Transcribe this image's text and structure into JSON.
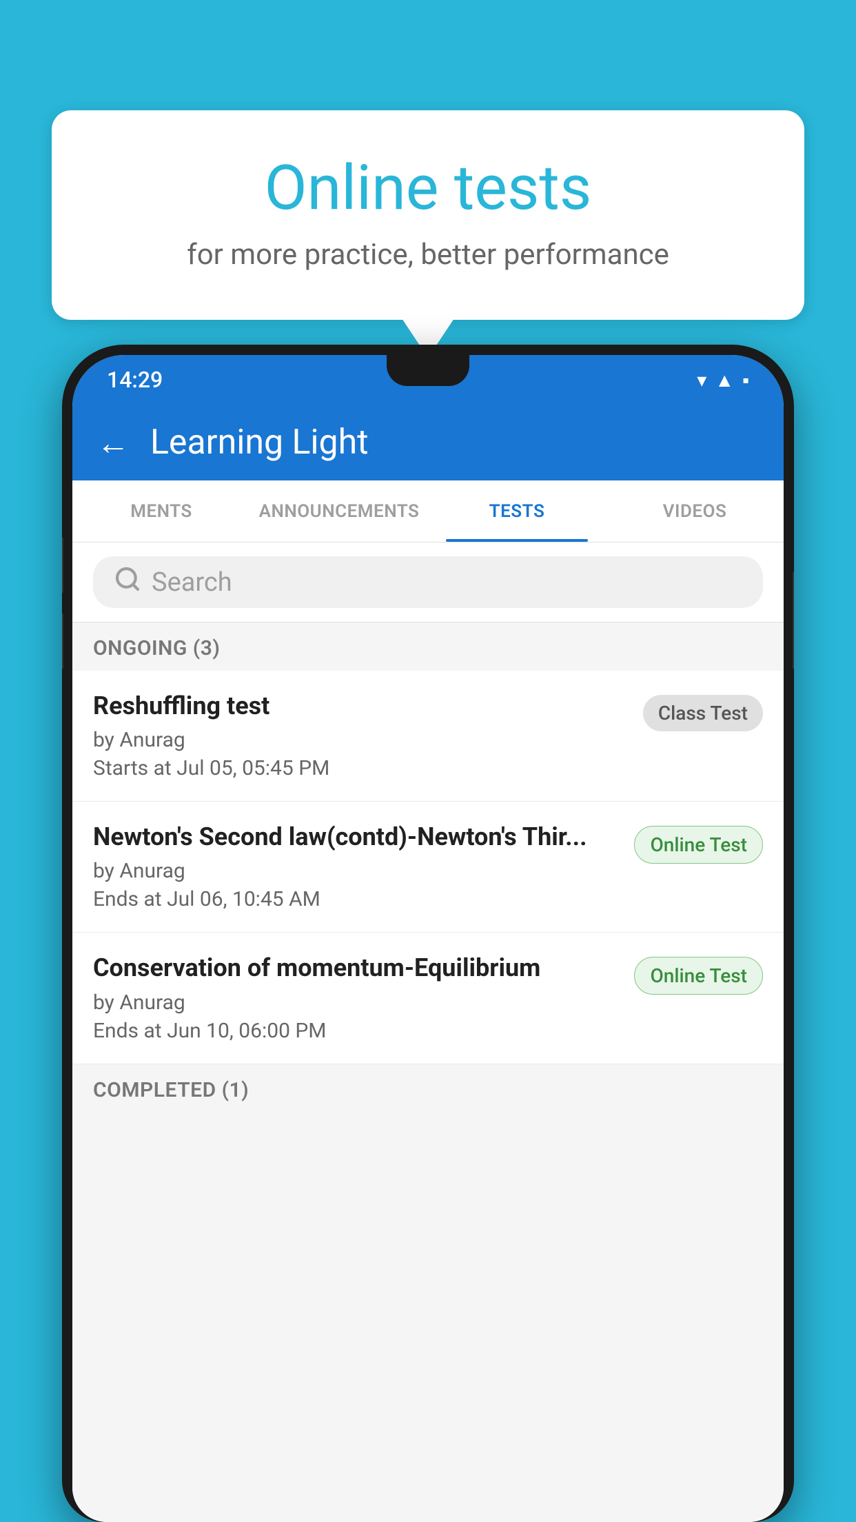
{
  "background_color": "#29b6d8",
  "speech_bubble": {
    "title": "Online tests",
    "subtitle": "for more practice, better performance"
  },
  "phone": {
    "status_bar": {
      "time": "14:29",
      "icons": [
        "wifi",
        "signal",
        "battery"
      ]
    },
    "app_bar": {
      "back_label": "←",
      "title": "Learning Light"
    },
    "tabs": [
      {
        "label": "MENTS",
        "active": false
      },
      {
        "label": "ANNOUNCEMENTS",
        "active": false
      },
      {
        "label": "TESTS",
        "active": true
      },
      {
        "label": "VIDEOS",
        "active": false
      }
    ],
    "search": {
      "placeholder": "Search"
    },
    "ongoing_section": {
      "title": "ONGOING (3)"
    },
    "test_items": [
      {
        "title": "Reshuffling test",
        "author": "by Anurag",
        "time_label": "Starts at",
        "time_value": "Jul 05, 05:45 PM",
        "badge": "Class Test",
        "badge_type": "class"
      },
      {
        "title": "Newton's Second law(contd)-Newton's Thir...",
        "author": "by Anurag",
        "time_label": "Ends at",
        "time_value": "Jul 06, 10:45 AM",
        "badge": "Online Test",
        "badge_type": "online"
      },
      {
        "title": "Conservation of momentum-Equilibrium",
        "author": "by Anurag",
        "time_label": "Ends at",
        "time_value": "Jun 10, 06:00 PM",
        "badge": "Online Test",
        "badge_type": "online"
      }
    ],
    "completed_section": {
      "title": "COMPLETED (1)"
    }
  }
}
